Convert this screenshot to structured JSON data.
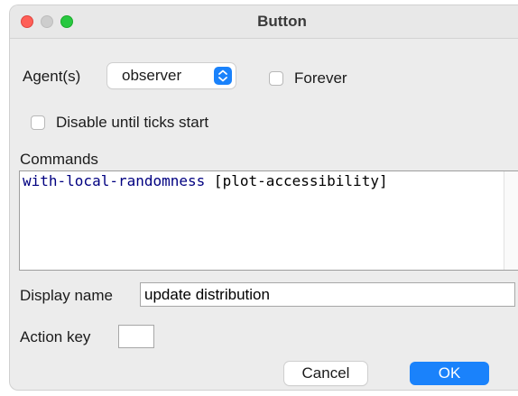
{
  "window": {
    "title": "Button"
  },
  "agent": {
    "label": "Agent(s)",
    "selected": "observer"
  },
  "forever": {
    "label": "Forever",
    "checked": false
  },
  "disable_until_ticks": {
    "label": "Disable until ticks start",
    "checked": false
  },
  "commands": {
    "label": "Commands",
    "code_keyword": "with-local-randomness",
    "code_rest": " [plot-accessibility]"
  },
  "display_name": {
    "label": "Display name",
    "value": "update distribution"
  },
  "action_key": {
    "label": "Action key",
    "value": ""
  },
  "buttons": {
    "cancel": "Cancel",
    "ok": "OK"
  },
  "colors": {
    "accent": "#1a82fb",
    "close": "#fe5f57",
    "maximize": "#28c840",
    "keyword": "#000080"
  }
}
